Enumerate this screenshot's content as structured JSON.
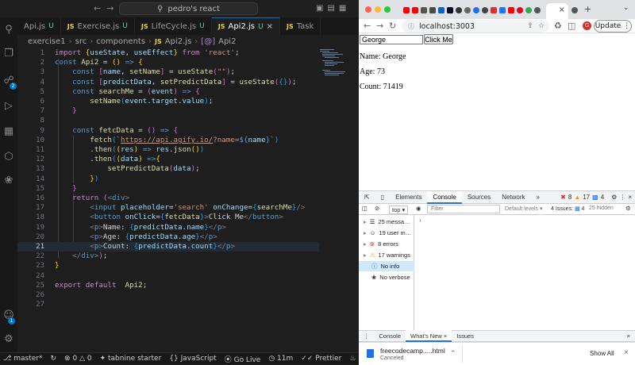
{
  "vscode": {
    "title": "pedro's react",
    "tabs": [
      {
        "label": "Api.js",
        "status": "U"
      },
      {
        "label": "Exercise.js",
        "status": "U"
      },
      {
        "label": "LifeCycle.js",
        "status": "U"
      },
      {
        "label": "Api2.js",
        "status": "U"
      },
      {
        "label": "Task",
        "status": ""
      }
    ],
    "breadcrumb": [
      "exercise1",
      "src",
      "components",
      "Api2.js",
      "Api2"
    ],
    "line_numbers": [
      "1",
      "2",
      "3",
      "4",
      "5",
      "6",
      "7",
      "8",
      "9",
      "10",
      "11",
      "12",
      "13",
      "14",
      "15",
      "16",
      "17",
      "18",
      "19",
      "20",
      "21",
      "22",
      "23",
      "24",
      "25",
      "26",
      "27"
    ],
    "badges": {
      "source_control": "2",
      "account": "1"
    },
    "status": {
      "branch": "master*",
      "errors": "0",
      "warnings": "0",
      "tabnine": "tabnine starter",
      "language": "JavaScript",
      "golive": "Go Live",
      "time": "11m",
      "prettier": "Prettier"
    }
  },
  "chrome": {
    "url": "localhost:3003",
    "update_label": "Update",
    "avatar_letter": "G",
    "page": {
      "input_value": "George",
      "button_label": "Click Me",
      "name_line": "Name: George",
      "age_line": "Age: 73",
      "count_line": "Count: 71419"
    },
    "devtools": {
      "tabs": [
        "Elements",
        "Console",
        "Sources",
        "Network"
      ],
      "errors_count": "8",
      "warnings_count": "17",
      "info_count": "4",
      "context": "top",
      "filter_placeholder": "Filter",
      "levels": "Default levels",
      "issues": "4 Issues:",
      "issues_count": "4",
      "hidden": "25 hidden",
      "sidebar": [
        {
          "label": "25 messa…"
        },
        {
          "label": "19 user m…"
        },
        {
          "label": "8 errors"
        },
        {
          "label": "17 warnings"
        },
        {
          "label": "No info"
        },
        {
          "label": "No verbose"
        }
      ],
      "drawer_tabs": [
        "Console",
        "What's New",
        "Issues"
      ]
    },
    "download": {
      "filename": "freecodecamp.....html",
      "status": "Canceled",
      "show_all": "Show All"
    }
  },
  "colors": {
    "accent": "#0078d4",
    "error": "#d93025",
    "warning": "#f29900",
    "info": "#1a73e8"
  }
}
